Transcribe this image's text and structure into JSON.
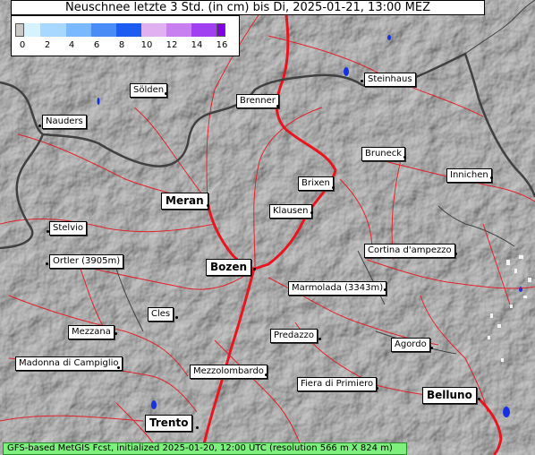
{
  "title": "Neuschnee letzte 3 Std. (in cm) bis Di, 2025-01-21, 13:00 MEZ",
  "legend": {
    "ticks": [
      "0",
      "2",
      "4",
      "6",
      "8",
      "10",
      "12",
      "14",
      "16"
    ],
    "colors": [
      "#c8c8c8",
      "#d6f2ff",
      "#a8d8ff",
      "#7ab8ff",
      "#4a8cf5",
      "#1c5cf0",
      "#e0b0f0",
      "#c880f0",
      "#a040f0",
      "#8000e0"
    ]
  },
  "places": [
    {
      "name": "Sölden"
    },
    {
      "name": "Brenner"
    },
    {
      "name": "Steinhaus"
    },
    {
      "name": "Nauders"
    },
    {
      "name": "Bruneck"
    },
    {
      "name": "Innichen"
    },
    {
      "name": "Brixen"
    },
    {
      "name": "Meran"
    },
    {
      "name": "Klausen"
    },
    {
      "name": "Stelvio"
    },
    {
      "name": "Cortina d'ampezzo"
    },
    {
      "name": "Ortler (3905m)"
    },
    {
      "name": "Bozen"
    },
    {
      "name": "Marmolada (3343m)"
    },
    {
      "name": "Cles"
    },
    {
      "name": "Mezzana"
    },
    {
      "name": "Predazzo"
    },
    {
      "name": "Agordo"
    },
    {
      "name": "Madonna di Campiglio"
    },
    {
      "name": "Mezzolombardo"
    },
    {
      "name": "Fiera di Primiero"
    },
    {
      "name": "Belluno"
    },
    {
      "name": "Trento"
    }
  ],
  "footer": "GFS-based MetGIS Fcst, initialized 2025-01-20, 12:00 UTC  (resolution 566 m X 824 m)",
  "colors": {
    "river": "#e8141e",
    "border": "#404040",
    "lake": "#1530e0",
    "footer_bg": "#7df07d"
  }
}
